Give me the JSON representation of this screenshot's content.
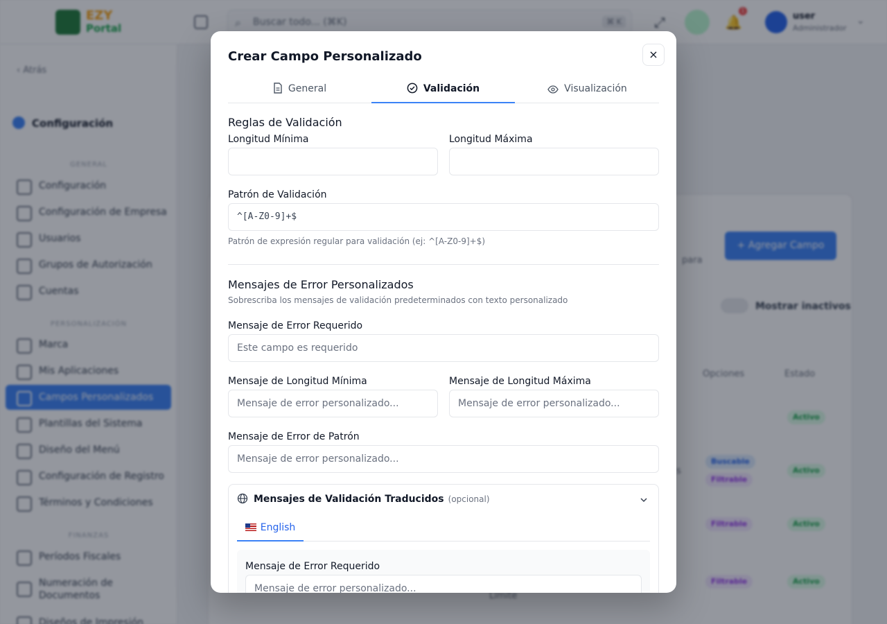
{
  "topbar": {
    "logo_line1": "EZY",
    "logo_line2": "Portal",
    "search_placeholder": "Buscar todo... (⌘K)",
    "search_shortcut": "⌘ K",
    "notifications_count": "1",
    "user_name": "user",
    "user_role": "Administrador"
  },
  "sidebar": {
    "back_label": "Atrás",
    "title": "Configuración",
    "sections": [
      {
        "label": "GENERAL"
      },
      {
        "label": "PERSONALIZACIÓN"
      },
      {
        "label": "FINANZAS"
      }
    ],
    "items": [
      {
        "label": "Configuración"
      },
      {
        "label": "Configuración de Empresa"
      },
      {
        "label": "Usuarios"
      },
      {
        "label": "Grupos de Autorización"
      },
      {
        "label": "Cuentas"
      },
      {
        "label": "Marca"
      },
      {
        "label": "Mis Aplicaciones"
      },
      {
        "label": "Campos Personalizados"
      },
      {
        "label": "Plantillas del Sistema"
      },
      {
        "label": "Diseño del Menú"
      },
      {
        "label": "Configuración de Registro"
      },
      {
        "label": "Términos y Condiciones"
      },
      {
        "label": "Períodos Fiscales"
      },
      {
        "label": "Numeración de Documentos"
      },
      {
        "label": "Diseños de Impresión"
      }
    ]
  },
  "background": {
    "add_button": "+ Agregar Campo",
    "show_inactive": "Mostrar inactivos",
    "columns": [
      "Opciones",
      "Estado"
    ],
    "fragments": [
      "para",
      "s",
      "Límite"
    ],
    "badges": {
      "active": "Activo",
      "searchable": "Buscable",
      "filterable": "Filtrable"
    }
  },
  "modal": {
    "title": "Crear Campo Personalizado",
    "close_icon": "×",
    "tabs": [
      {
        "label": "General",
        "icon": "document-icon"
      },
      {
        "label": "Validación",
        "icon": "check-circle-icon"
      },
      {
        "label": "Visualización",
        "icon": "eye-icon"
      }
    ],
    "active_tab": "Validación",
    "validation": {
      "heading": "Reglas de Validación",
      "min_length_label": "Longitud Mínima",
      "min_length_value": "",
      "max_length_label": "Longitud Máxima",
      "max_length_value": "",
      "pattern_label": "Patrón de Validación",
      "pattern_value": "^[A-Z0-9]+$",
      "pattern_hint": "Patrón de expresión regular para validación (ej: ^[A-Z0-9]+$)"
    },
    "errors": {
      "heading": "Mensajes de Error Personalizados",
      "subtitle": "Sobrescriba los mensajes de validación predeterminados con texto personalizado",
      "required_label": "Mensaje de Error Requerido",
      "required_placeholder": "Este campo es requerido",
      "min_label": "Mensaje de Longitud Mínima",
      "min_placeholder": "Mensaje de error personalizado...",
      "max_label": "Mensaje de Longitud Máxima",
      "max_placeholder": "Mensaje de error personalizado...",
      "pattern_label": "Mensaje de Error de Patrón",
      "pattern_placeholder": "Mensaje de error personalizado..."
    },
    "translations": {
      "heading": "Mensajes de Validación Traducidos",
      "optional": "(opcional)",
      "languages": [
        {
          "label": "English",
          "flag": "us-flag"
        }
      ],
      "required_label": "Mensaje de Error Requerido",
      "required_placeholder": "Mensaje de error personalizado..."
    }
  },
  "colors": {
    "accent": "#3b82f6",
    "overlay": "rgba(17,24,39,0.45)",
    "active_badge": "#16a34a"
  }
}
